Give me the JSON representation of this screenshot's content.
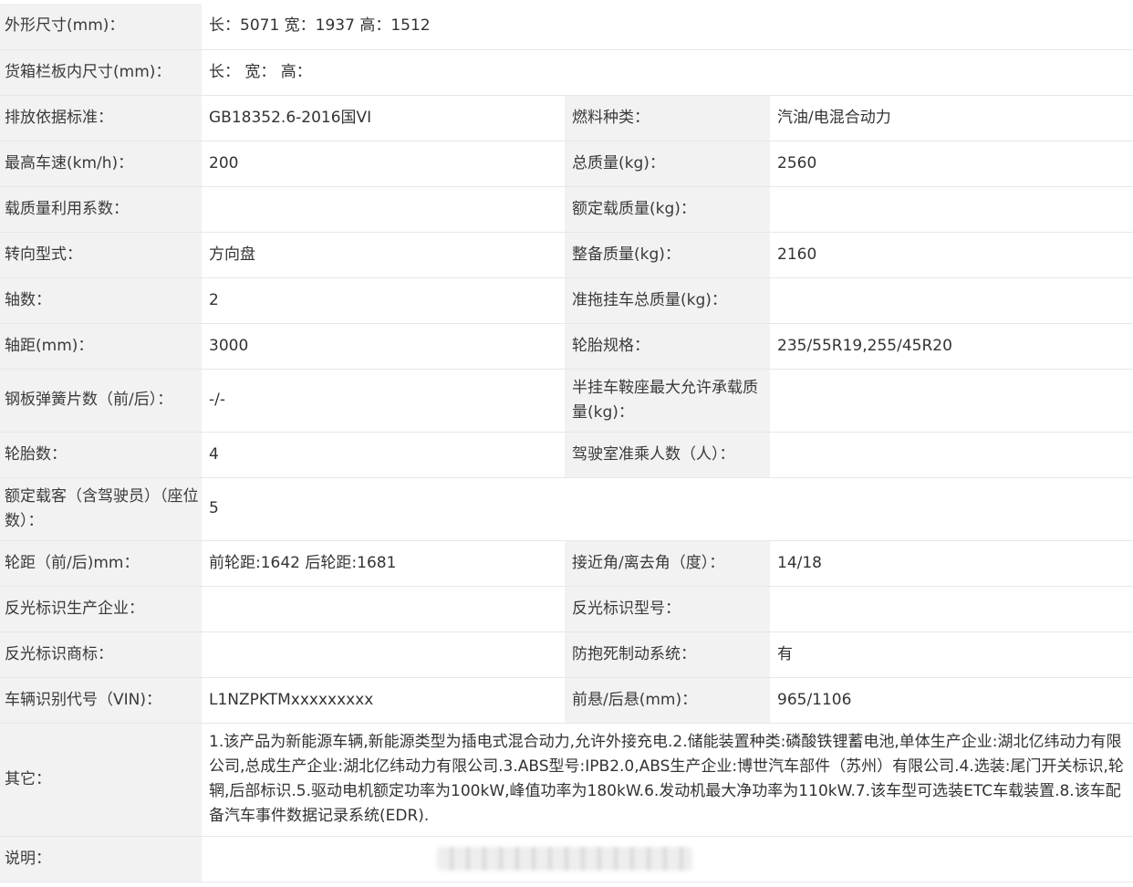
{
  "rows": {
    "dims": {
      "label": "外形尺寸(mm)：",
      "value": "长：5071 宽：1937 高：1512"
    },
    "cargo": {
      "label": "货箱栏板内尺寸(mm)：",
      "value": "长： 宽： 高："
    },
    "emission": {
      "label": "排放依据标准：",
      "value": "GB18352.6-2016国VI",
      "label2": "燃料种类：",
      "value2": "汽油/电混合动力"
    },
    "speed": {
      "label": "最高车速(km/h)：",
      "value": "200",
      "label2": "总质量(kg)：",
      "value2": "2560"
    },
    "loadcoef": {
      "label": "载质量利用系数：",
      "value": "",
      "label2": "额定载质量(kg)：",
      "value2": ""
    },
    "steering": {
      "label": "转向型式：",
      "value": "方向盘",
      "label2": "整备质量(kg)：",
      "value2": "2160"
    },
    "axles": {
      "label": "轴数：",
      "value": "2",
      "label2": "准拖挂车总质量(kg)：",
      "value2": ""
    },
    "wheelbase": {
      "label": "轴距(mm)：",
      "value": "3000",
      "label2": "轮胎规格：",
      "value2": "235/55R19,255/45R20"
    },
    "springs": {
      "label": "钢板弹簧片数（前/后）：",
      "value": "-/-",
      "label2": "半挂车鞍座最大允许承载质量(kg)：",
      "value2": ""
    },
    "tires": {
      "label": "轮胎数：",
      "value": "4",
      "label2": "驾驶室准乘人数（人）：",
      "value2": ""
    },
    "seats": {
      "label": "额定载客（含驾驶员）（座位数）：",
      "value": "5"
    },
    "track": {
      "label": "轮距（前/后)mm：",
      "value": "前轮距:1642 后轮距:1681",
      "label2": "接近角/离去角（度）：",
      "value2": "14/18"
    },
    "reflector_maker": {
      "label": "反光标识生产企业：",
      "value": "",
      "label2": "反光标识型号：",
      "value2": ""
    },
    "reflector_brand": {
      "label": "反光标识商标：",
      "value": "",
      "label2": "防抱死制动系统：",
      "value2": "有"
    },
    "vin": {
      "label": "车辆识别代号（VIN)：",
      "value": "L1NZPKTMxxxxxxxxx",
      "label2": "前悬/后悬(mm)：",
      "value2": "965/1106"
    },
    "other": {
      "label": "其它：",
      "value": "1.该产品为新能源车辆,新能源类型为插电式混合动力,允许外接充电.2.储能装置种类:磷酸铁锂蓄电池,单体生产企业:湖北亿纬动力有限公司,总成生产企业:湖北亿纬动力有限公司.3.ABS型号:IPB2.0,ABS生产企业:博世汽车部件（苏州）有限公司.4.选装:尾门开关标识,轮辋,后部标识.5.驱动电机额定功率为100kW,峰值功率为180kW.6.发动机最大净功率为110kW.7.该车型可选装ETC车载装置.8.该车配备汽车事件数据记录系统(EDR)."
    },
    "note": {
      "label": "说明：",
      "value": ""
    }
  }
}
